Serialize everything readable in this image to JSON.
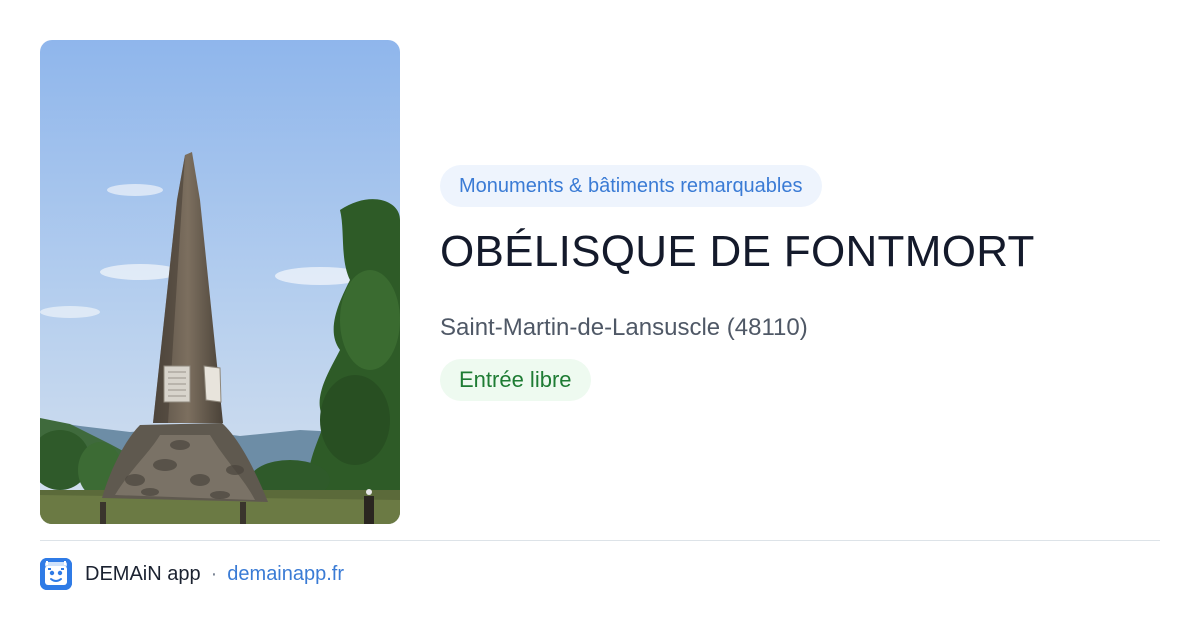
{
  "card": {
    "image_alt": "Obélisque en pierre sur un socle de rochers, entouré d'arbres, sous un ciel bleu",
    "category": "Monuments & bâtiments remarquables",
    "title": "OBÉLISQUE DE FONTMORT",
    "location": "Saint-Martin-de-Lansuscle (48110)",
    "access": "Entrée libre"
  },
  "footer": {
    "app_name": "DEMAiN app",
    "separator": "·",
    "link_label": "demainapp.fr"
  },
  "colors": {
    "category_text": "#3a7bd5",
    "category_bg": "#eef4fd",
    "access_text": "#1e7c34",
    "access_bg": "#eefaf0",
    "title": "#141a2b",
    "brand": "#2f7be6"
  },
  "icons": {
    "app_logo": "demain-app-logo-icon"
  }
}
